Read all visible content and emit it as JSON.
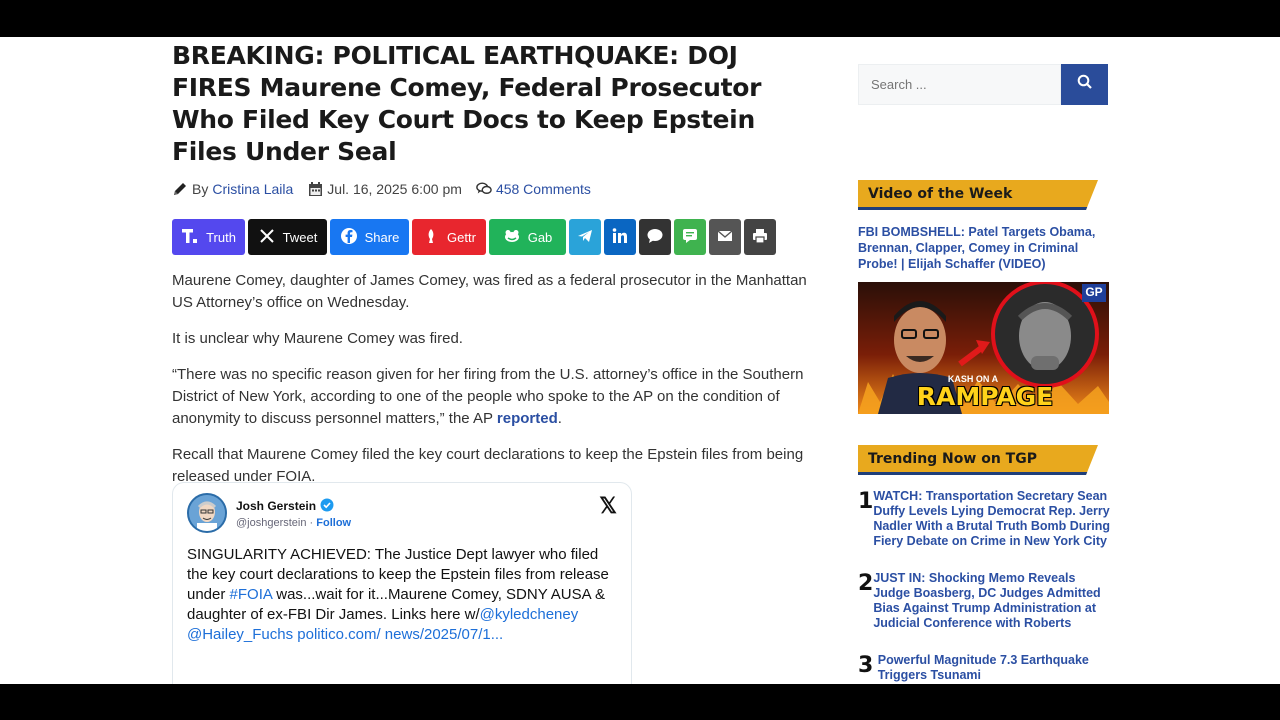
{
  "article": {
    "title": "BREAKING: POLITICAL EARTHQUAKE: DOJ FIRES Maurene Comey, Federal Prosecutor Who Filed Key Court Docs to Keep Epstein Files Under Seal",
    "by_label": "By",
    "author": "Cristina Laila",
    "date": "Jul. 16, 2025 6:00 pm",
    "comments": "458 Comments",
    "paragraphs": {
      "p1": "Maurene Comey, daughter of James Comey, was fired as a federal prosecutor in the Manhattan US Attorney’s office on Wednesday.",
      "p2": "It is unclear why Maurene Comey was fired.",
      "p3_text": "“There was no specific reason given for her firing from the U.S. attorney’s office in the Southern District of New York, according to one of the people who spoke to the AP on the condition of anonymity to discuss personnel matters,” the AP ",
      "p3_link": "reported",
      "p3_end": ".",
      "p4": "Recall that Maurene Comey filed the key court declarations to keep the Epstein files from being released under FOIA."
    }
  },
  "share": {
    "truth": "Truth",
    "tweet": "Tweet",
    "facebook": "Share",
    "gettr": "Gettr",
    "gab": "Gab",
    "colors": {
      "truth": "#5448ee",
      "tweet": "#111111",
      "facebook": "#1877f2",
      "gettr": "#e8262e",
      "gab": "#21b35a",
      "telegram": "#2aa3d9",
      "linkedin": "#0a66c2",
      "comment": "#333333",
      "sms": "#3fb34f",
      "email": "#555555",
      "print": "#444444"
    }
  },
  "tweet": {
    "name": "Josh Gerstein",
    "handle": "@joshgerstein",
    "dot": "·",
    "follow": "Follow",
    "x_logo": "𝕏",
    "body_1": "SINGULARITY ACHIEVED: The Justice Dept lawyer who filed the key court declarations to keep the Epstein files from release under ",
    "hashtag": "#FOIA",
    "body_2": " was...wait for it...Maurene Comey, SDNY AUSA  & daughter of ex-FBI Dir James. Links here w/",
    "mention1": "@kyledcheney",
    "space": " ",
    "mention2": "@Hailey_Fuchs",
    "url": " politico.com/ news/2025/07/1..."
  },
  "sidebar": {
    "search_placeholder": "Search ...",
    "video_heading": "Video of the Week",
    "video_title": "FBI BOMBSHELL: Patel Targets Obama, Brennan, Clapper, Comey in Criminal Probe! | Elijah Schaffer (VIDEO)",
    "thumb_caption_small": "KASH ON A",
    "thumb_caption_big": "RAMPAGE",
    "thumb_badge": "GP",
    "trending_heading": "Trending Now on TGP",
    "trending": [
      {
        "num": "1",
        "text": "WATCH: Transportation Secretary Sean Duffy Levels Lying Democrat Rep. Jerry Nadler With a Brutal Truth Bomb During Fiery Debate on Crime in New York City"
      },
      {
        "num": "2",
        "text": "JUST IN: Shocking Memo Reveals Judge Boasberg, DC Judges Admitted Bias Against Trump Administration at Judicial Conference with Roberts"
      },
      {
        "num": "3",
        "text": "Powerful Magnitude 7.3 Earthquake Triggers Tsunami"
      }
    ]
  }
}
